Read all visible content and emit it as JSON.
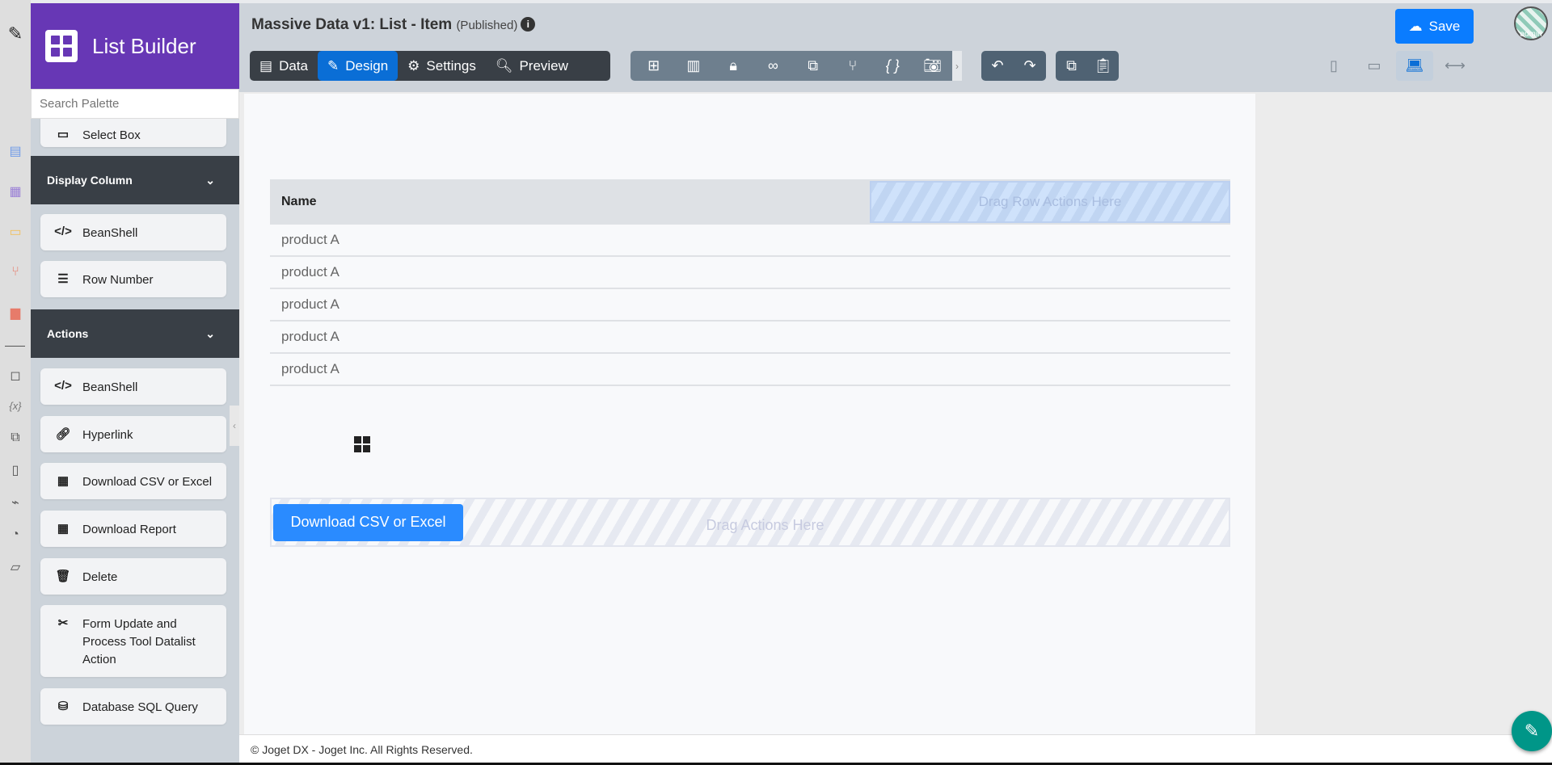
{
  "brand": {
    "title": "List Builder"
  },
  "header": {
    "title": "Massive Data v1: List - Item",
    "status": "(Published)",
    "save_label": "Save",
    "avatar_label": "admin"
  },
  "tabs": [
    {
      "label": "Data"
    },
    {
      "label": "Design"
    },
    {
      "label": "Settings"
    },
    {
      "label": "Preview"
    }
  ],
  "search": {
    "placeholder": "Search Palette"
  },
  "palette": {
    "top_item": "Select Box",
    "sections": [
      {
        "title": "Display Column",
        "items": [
          "BeanShell",
          "Row Number"
        ]
      },
      {
        "title": "Actions",
        "items": [
          "BeanShell",
          "Hyperlink",
          "Download CSV or Excel",
          "Download Report",
          "Delete",
          "Form Update and Process Tool Datalist Action",
          "Database SQL Query"
        ]
      }
    ]
  },
  "canvas": {
    "column_header": "Name",
    "row_actions_placeholder": "Drag Row Actions Here",
    "rows": [
      "product A",
      "product A",
      "product A",
      "product A",
      "product A"
    ],
    "action_button": "Download CSV or Excel",
    "actions_placeholder": "Drag Actions Here"
  },
  "footer": {
    "text": "© Joget DX - Joget Inc. All Rights Reserved."
  },
  "colors": {
    "brand": "#6737b5",
    "active_tab": "#0a6ed6",
    "save": "#0a7cff",
    "fab": "#009688"
  }
}
